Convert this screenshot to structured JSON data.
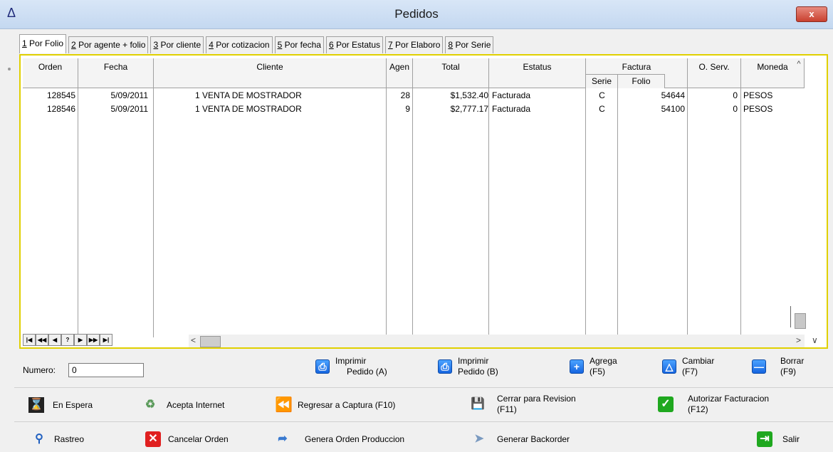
{
  "window": {
    "title": "Pedidos",
    "close": "x"
  },
  "tabs": [
    {
      "key": "1",
      "rest": " Por Folio"
    },
    {
      "key": "2",
      "rest": " Por agente + folio"
    },
    {
      "key": "3",
      "rest": " Por cliente"
    },
    {
      "key": "4",
      "rest": " Por cotizacion"
    },
    {
      "key": "5",
      "rest": " Por fecha"
    },
    {
      "key": "6",
      "rest": " Por Estatus"
    },
    {
      "key": "7",
      "rest": " Por Elaboro"
    },
    {
      "key": "8",
      "rest": " Por Serie"
    }
  ],
  "columns": {
    "orden": "Orden",
    "fecha": "Fecha",
    "cliente": "Cliente",
    "agen": "Agen",
    "total": "Total",
    "estatus": "Estatus",
    "factura": "Factura",
    "serie": "Serie",
    "folio": "Folio",
    "oserv": "O. Serv.",
    "moneda": "Moneda"
  },
  "rows": [
    {
      "orden": "128545",
      "fecha": "5/09/2011",
      "cliente": "1  VENTA DE MOSTRADOR",
      "agen": "28",
      "total": "$1,532.40",
      "estatus": "Facturada",
      "serie": "C",
      "folio": "54644",
      "oserv": "0",
      "moneda": "PESOS"
    },
    {
      "orden": "128546",
      "fecha": "5/09/2011",
      "cliente": "1  VENTA DE MOSTRADOR",
      "agen": "9",
      "total": "$2,777.17",
      "estatus": "Facturada",
      "serie": "C",
      "folio": "54100",
      "oserv": "0",
      "moneda": "PESOS"
    }
  ],
  "nav": [
    "|◀",
    "◀◀",
    "◀",
    "?",
    "▶",
    "▶▶",
    "▶|"
  ],
  "numero": {
    "label": "Numero:",
    "value": "0"
  },
  "toolbar1": [
    {
      "l1": "Imprimir",
      "l2": "Pedido (A)"
    },
    {
      "l1": "Imprimir",
      "l2": "Pedido (B)"
    },
    {
      "l1": "Agrega",
      "l2": "(F5)"
    },
    {
      "l1": "Cambiar",
      "l2": "(F7)"
    },
    {
      "l1": "Borrar",
      "l2": "(F9)"
    }
  ],
  "toolbar2": {
    "espera": "En Espera",
    "internet": "Acepta Internet",
    "regresar": "Regresar a Captura (F10)",
    "cerrar_l1": "Cerrar para Revision",
    "cerrar_l2": "(F11)",
    "autorizar_l1": "Autorizar Facturacion",
    "autorizar_l2": "(F12)"
  },
  "toolbar3": {
    "rastreo": "Rastreo",
    "cancelar": "Cancelar Orden",
    "genera": "Genera Orden Produccion",
    "backorder": "Generar Backorder",
    "salir": "Salir"
  },
  "colors": {
    "accent_yellow": "#e0d000",
    "blue_button": "#1565e0",
    "green": "#1fa81f",
    "red": "#e02020"
  }
}
